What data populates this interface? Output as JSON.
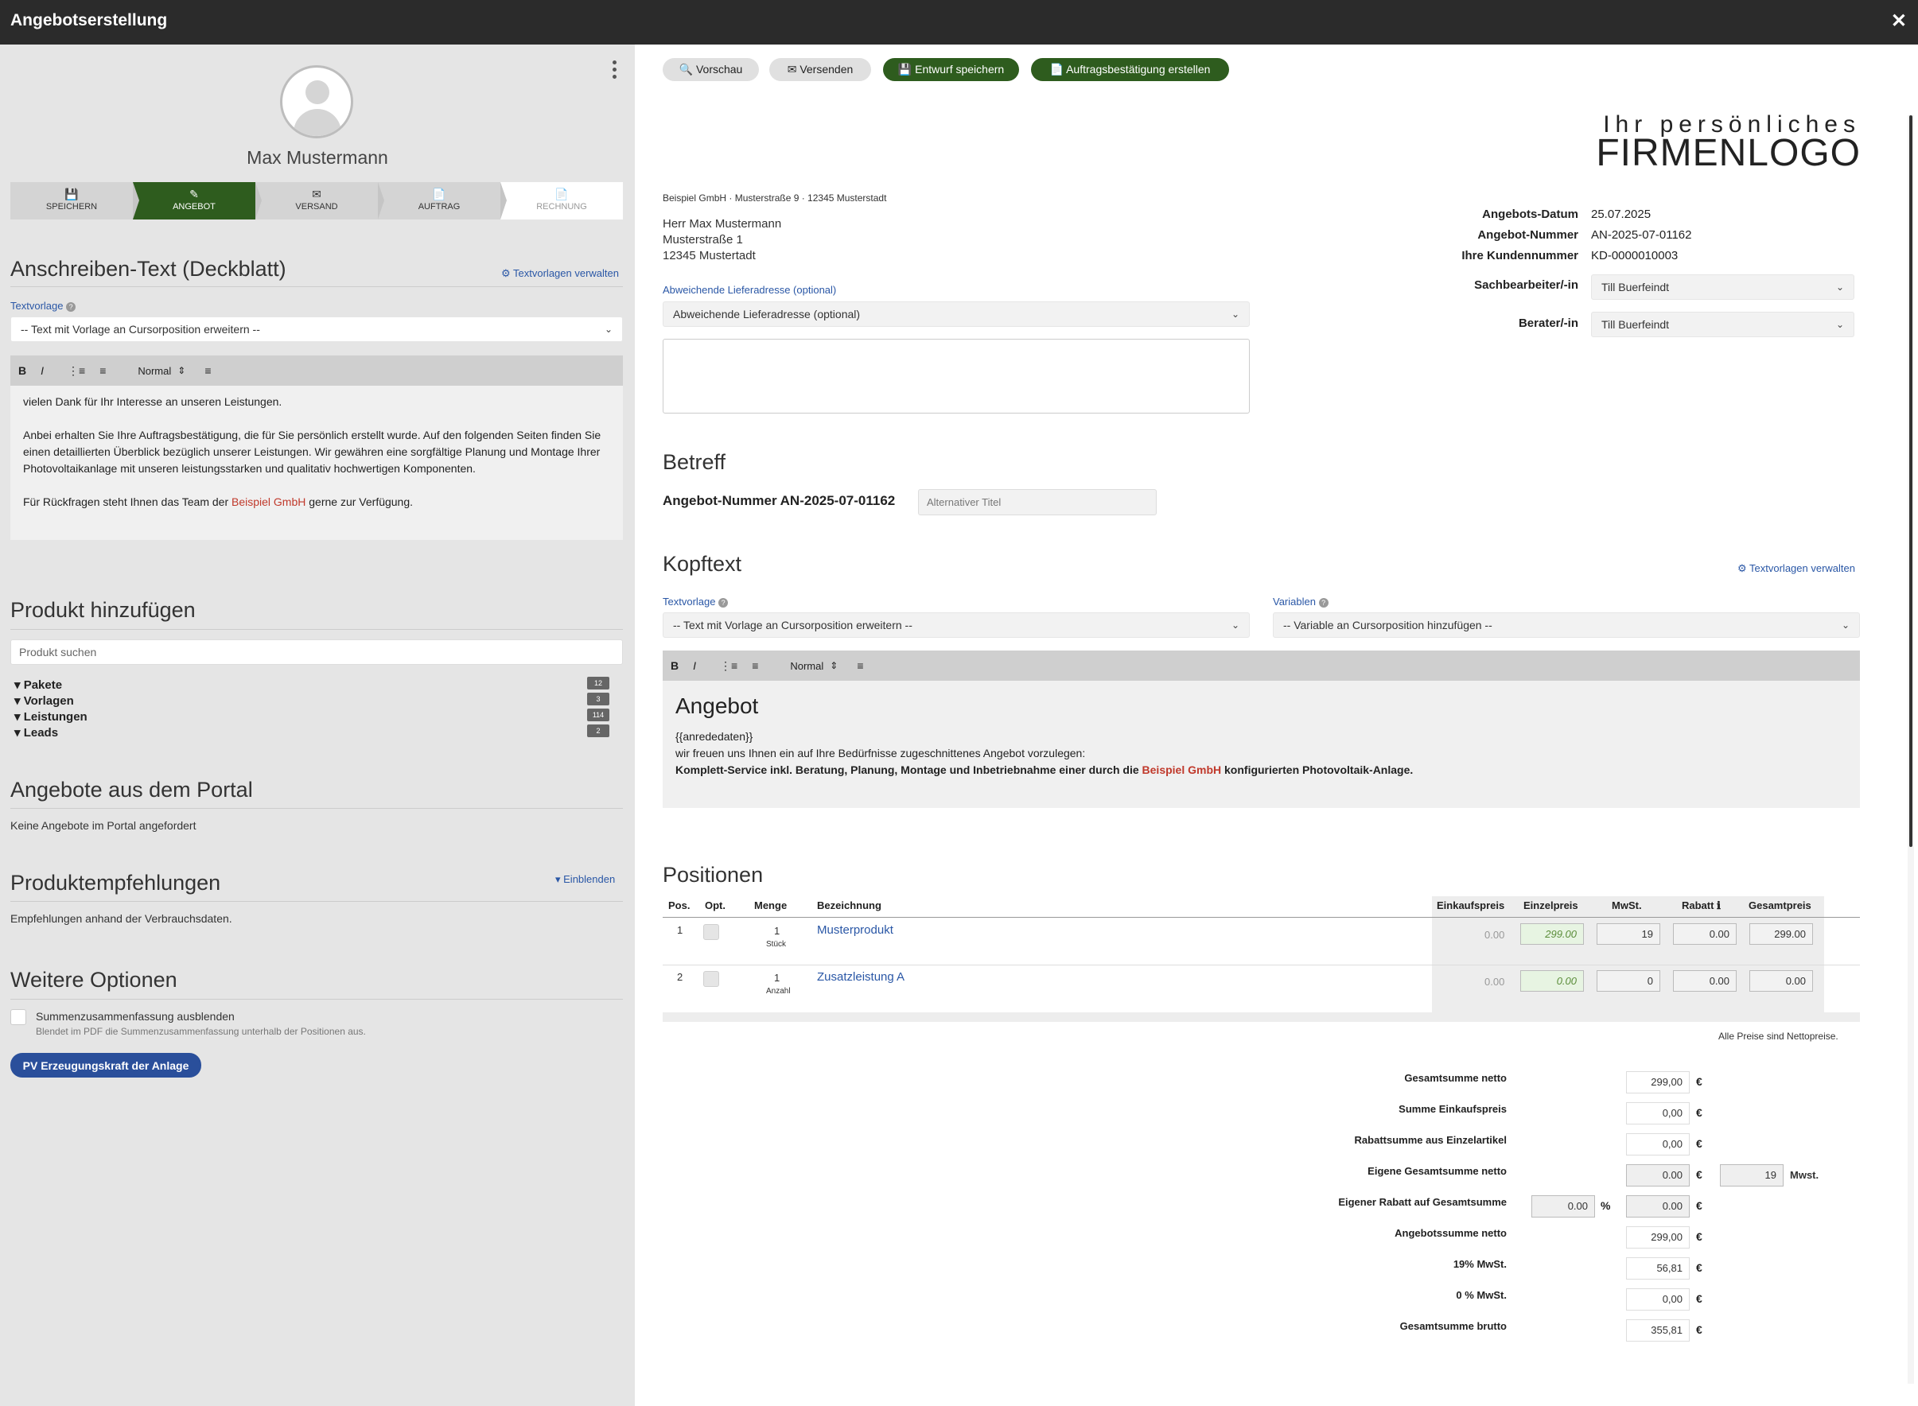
{
  "window": {
    "title": "Angebotserstellung",
    "close": "✕"
  },
  "customer": {
    "name": "Max Mustermann"
  },
  "steps": [
    {
      "icon": "💾",
      "label": "SPEICHERN"
    },
    {
      "icon": "✎",
      "label": "ANGEBOT"
    },
    {
      "icon": "✉",
      "label": "VERSAND"
    },
    {
      "icon": "📄",
      "label": "AUFTRAG"
    },
    {
      "icon": "📄",
      "label": "RECHNUNG"
    }
  ],
  "cover": {
    "title": "Anschreiben-Text (Deckblatt)",
    "manage_link": "⚙ Textvorlagen verwalten",
    "template_label": "Textvorlage",
    "template_select": "-- Text mit Vorlage an Cursorposition erweitern --",
    "toolbar": {
      "bold": "B",
      "italic": "I",
      "ol": "⋮≡",
      "ul": "≡",
      "format": "Normal",
      "format_arrow": "⇕",
      "align": "≡"
    },
    "p1": "vielen Dank für Ihr Interesse an unseren Leistungen.",
    "p2": "Anbei erhalten Sie Ihre Auftragsbestätigung, die für Sie persönlich erstellt wurde. Auf den folgenden Seiten finden Sie einen detaillierten Überblick bezüglich unserer Leistungen. Wir gewähren eine sorgfältige Planung und Montage Ihrer Photovoltaikanlage mit unseren leistungsstarken und qualitativ hochwertigen Komponenten.",
    "p3_pre": "Für Rückfragen steht Ihnen das Team der ",
    "p3_company": "Beispiel GmbH",
    "p3_post": " gerne zur Verfügung."
  },
  "products": {
    "title": "Produkt hinzufügen",
    "search_placeholder": "Produkt suchen",
    "tree": [
      {
        "label": "Pakete",
        "count": "12"
      },
      {
        "label": "Vorlagen",
        "count": "3"
      },
      {
        "label": "Leistungen",
        "count": "114"
      },
      {
        "label": "Leads",
        "count": "2"
      }
    ]
  },
  "portal": {
    "title": "Angebote aus dem Portal",
    "text": "Keine Angebote im Portal angefordert"
  },
  "recommend": {
    "title": "Produktempfehlungen",
    "toggle": "▾ Einblenden",
    "text": "Empfehlungen anhand der Verbrauchsdaten."
  },
  "options": {
    "title": "Weitere Optionen",
    "check_label": "Summenzusammenfassung ausblenden",
    "check_hint": "Blendet im PDF die Summenzusammenfassung unterhalb der Positionen aus.",
    "pv_button": "PV Erzeugungskraft der Anlage"
  },
  "actions": {
    "preview": "🔍 Vorschau",
    "send": "✉ Versenden",
    "save": "💾 Entwurf speichern",
    "confirm": "📄 Auftragsbestätigung erstellen"
  },
  "logo": {
    "line1": "Ihr persönliches",
    "line2": "FIRMENLOGO"
  },
  "sender": "Beispiel GmbH · Musterstraße 9 · 12345 Musterstadt",
  "recipient": {
    "l1": "Herr Max Mustermann",
    "l2": "Musterstraße 1",
    "l3": "12345 Mustertadt"
  },
  "meta": {
    "date_label": "Angebots-Datum",
    "date": "25.07.2025",
    "no_label": "Angebot-Nummer",
    "no": "AN-2025-07-01162",
    "cust_label": "Ihre Kundennummer",
    "cust": "KD-0000010003",
    "clerk_label": "Sachbearbeiter/-in",
    "clerk": "Till Buerfeindt",
    "advisor_label": "Berater/-in",
    "advisor": "Till Buerfeindt"
  },
  "delivery": {
    "label": "Abweichende Lieferadresse (optional)",
    "select": "Abweichende Lieferadresse (optional)"
  },
  "subject": {
    "title": "Betreff",
    "number": "Angebot-Nummer AN-2025-07-01162",
    "alt_placeholder": "Alternativer Titel"
  },
  "head": {
    "title": "Kopftext",
    "manage_link": "⚙ Textvorlagen verwalten",
    "template_label": "Textvorlage",
    "template_select": "-- Text mit Vorlage an Cursorposition erweitern --",
    "var_label": "Variablen",
    "var_select": "-- Variable an Cursorposition hinzufügen --",
    "heading": "Angebot",
    "line1": "{{anrededaten}}",
    "line2": "wir freuen uns Ihnen ein auf Ihre Bedürfnisse zugeschnittenes Angebot vorzulegen:",
    "line3_pre": "Komplett-Service inkl. Beratung, Planung, Montage und Inbetriebnahme einer durch die ",
    "line3_company": "Beispiel GmbH",
    "line3_post": " konfigurierten Photovoltaik-Anlage."
  },
  "positions": {
    "title": "Positionen",
    "headers": {
      "pos": "Pos.",
      "opt": "Opt.",
      "qty": "Menge",
      "name": "Bezeichnung",
      "ek": "Einkaufspreis",
      "ep": "Einzelpreis",
      "vat": "MwSt.",
      "disc": "Rabatt ℹ",
      "total": "Gesamtpreis"
    },
    "rows": [
      {
        "pos": "1",
        "qty": "1",
        "unit": "Stück",
        "name": "Musterprodukt",
        "ek": "0.00",
        "ep": "299.00",
        "vat": "19",
        "disc": "0.00",
        "total": "299.00"
      },
      {
        "pos": "2",
        "qty": "1",
        "unit": "Anzahl",
        "name": "Zusatzleistung A",
        "ek": "0.00",
        "ep": "0.00",
        "vat": "0",
        "disc": "0.00",
        "total": "0.00"
      }
    ],
    "net_note": "Alle Preise sind Nettopreise."
  },
  "sums": {
    "currency": "€",
    "percent": "%",
    "vat_suffix": "Mwst.",
    "rows": [
      {
        "label": "Gesamtsumme netto",
        "value": "299,00"
      },
      {
        "label": "Summe Einkaufspreis",
        "value": "0,00"
      },
      {
        "label": "Rabattsumme aus Einzelartikel",
        "value": "0,00"
      },
      {
        "label": "Eigene Gesamtsumme netto",
        "value": "0.00",
        "vat": "19"
      },
      {
        "label": "Eigener Rabatt auf Gesamtsumme",
        "value": "0.00",
        "pct": "0.00"
      },
      {
        "label": "Angebotssumme netto",
        "value": "299,00"
      },
      {
        "label": "19% MwSt.",
        "value": "56,81"
      },
      {
        "label": "0 % MwSt.",
        "value": "0,00"
      },
      {
        "label": "Gesamtsumme brutto",
        "value": "355,81"
      }
    ]
  }
}
